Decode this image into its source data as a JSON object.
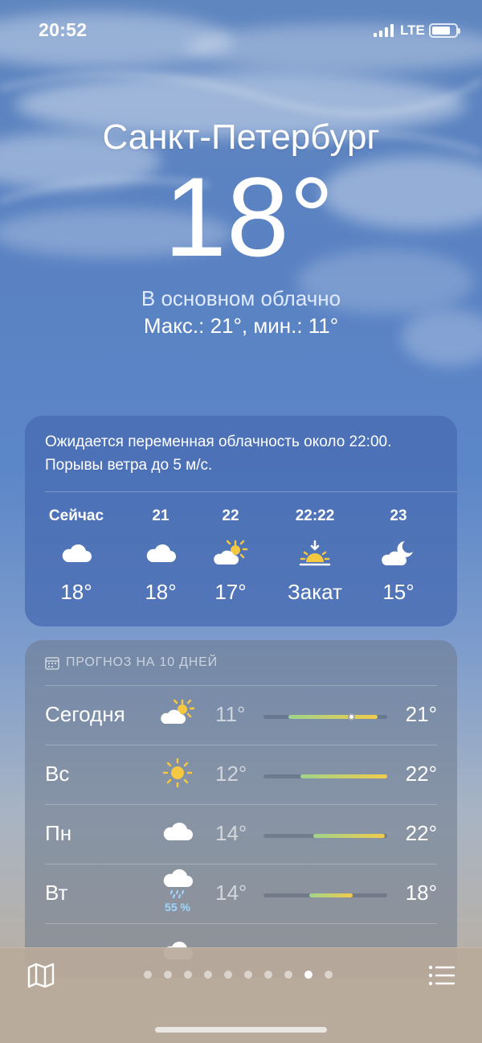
{
  "status": {
    "time": "20:52",
    "network": "LTE"
  },
  "current": {
    "city": "Санкт-Петербург",
    "temperature": "18°",
    "condition": "В основном облачно",
    "hilo": "Макс.: 21°, мин.: 11°"
  },
  "hourly": {
    "summary": "Ожидается переменная облачность около 22:00. Порывы ветра до 5 м/с.",
    "items": [
      {
        "label": "Сейчас",
        "icon": "cloud-icon",
        "temp": "18°"
      },
      {
        "label": "21",
        "icon": "cloud-icon",
        "temp": "18°"
      },
      {
        "label": "22",
        "icon": "partly-cloudy-sun-icon",
        "temp": "17°"
      },
      {
        "label": "22:22",
        "icon": "sunset-icon",
        "temp": "Закат"
      },
      {
        "label": "23",
        "icon": "partly-cloudy-moon-icon",
        "temp": "15°"
      }
    ]
  },
  "daily": {
    "header": "ПРОГНОЗ НА 10 ДНЕЙ",
    "rows": [
      {
        "day": "Сегодня",
        "icon": "partly-cloudy-sun-icon",
        "min": "11°",
        "max": "21°",
        "range_start": 0.2,
        "range_end": 0.92,
        "current_marker": 0.71
      },
      {
        "day": "Вс",
        "icon": "sun-icon",
        "min": "12°",
        "max": "22°",
        "range_start": 0.3,
        "range_end": 1.0
      },
      {
        "day": "Пн",
        "icon": "cloud-icon",
        "min": "14°",
        "max": "22°",
        "range_start": 0.4,
        "range_end": 0.98
      },
      {
        "day": "Вт",
        "icon": "cloud-rain-icon",
        "precip": "55 %",
        "min": "14°",
        "max": "18°",
        "range_start": 0.37,
        "range_end": 0.72
      }
    ]
  },
  "colors": {
    "bar_green": "#9fd38a",
    "bar_yellow": "#f2cc4a",
    "precip_blue": "#9fd6ff"
  },
  "pager": {
    "count": 10,
    "active": 8
  }
}
